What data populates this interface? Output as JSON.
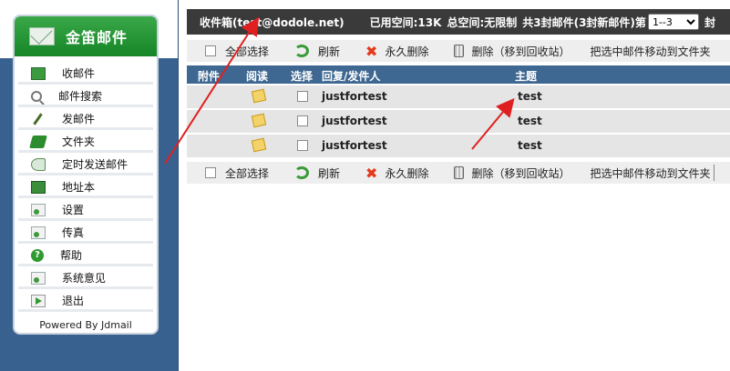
{
  "brand": {
    "title": "金笛邮件",
    "icon": "envelope-icon"
  },
  "sidebar": {
    "items": [
      {
        "label": "收邮件",
        "icon": "inbox-icon"
      },
      {
        "label": "邮件搜索",
        "icon": "search-icon"
      },
      {
        "label": "发邮件",
        "icon": "compose-icon"
      },
      {
        "label": "文件夹",
        "icon": "folder-icon"
      },
      {
        "label": "定时发送邮件",
        "icon": "scheduled-send-icon"
      },
      {
        "label": "地址本",
        "icon": "address-book-icon"
      },
      {
        "label": "设置",
        "icon": "settings-icon"
      },
      {
        "label": "传真",
        "icon": "fax-icon"
      },
      {
        "label": "帮助",
        "icon": "help-icon"
      },
      {
        "label": "系统意见",
        "icon": "feedback-icon"
      },
      {
        "label": "退出",
        "icon": "exit-icon"
      }
    ],
    "powered_by": "Powered By Jdmail"
  },
  "header": {
    "mailbox": "收件箱(test@dodole.net)",
    "used_space": "已用空间:13K",
    "total_space": "总空间:无限制",
    "count": "共3封邮件(3封新邮件)",
    "page_prefix": "第",
    "page_select": "1--3",
    "page_suffix": "封"
  },
  "toolbar": {
    "select_all": "全部选择",
    "refresh": "刷新",
    "delete_permanent": "永久删除",
    "delete_to_trash": "删除（移到回收站）",
    "move_to_folder": "把选中邮件移动到文件夹"
  },
  "table": {
    "columns": [
      "附件",
      "阅读",
      "选择",
      "回复/发件人",
      "主题"
    ],
    "rows": [
      {
        "sender": "justfortest",
        "subject": "test"
      },
      {
        "sender": "justfortest",
        "subject": "test"
      },
      {
        "sender": "justfortest",
        "subject": "test"
      }
    ]
  },
  "colors": {
    "sidebar_bg": "#39618f",
    "brand_green": "#1f8f2f",
    "header_bg": "#3a3a3a",
    "table_header_bg": "#3e6791",
    "arrow_red": "#e02020"
  }
}
